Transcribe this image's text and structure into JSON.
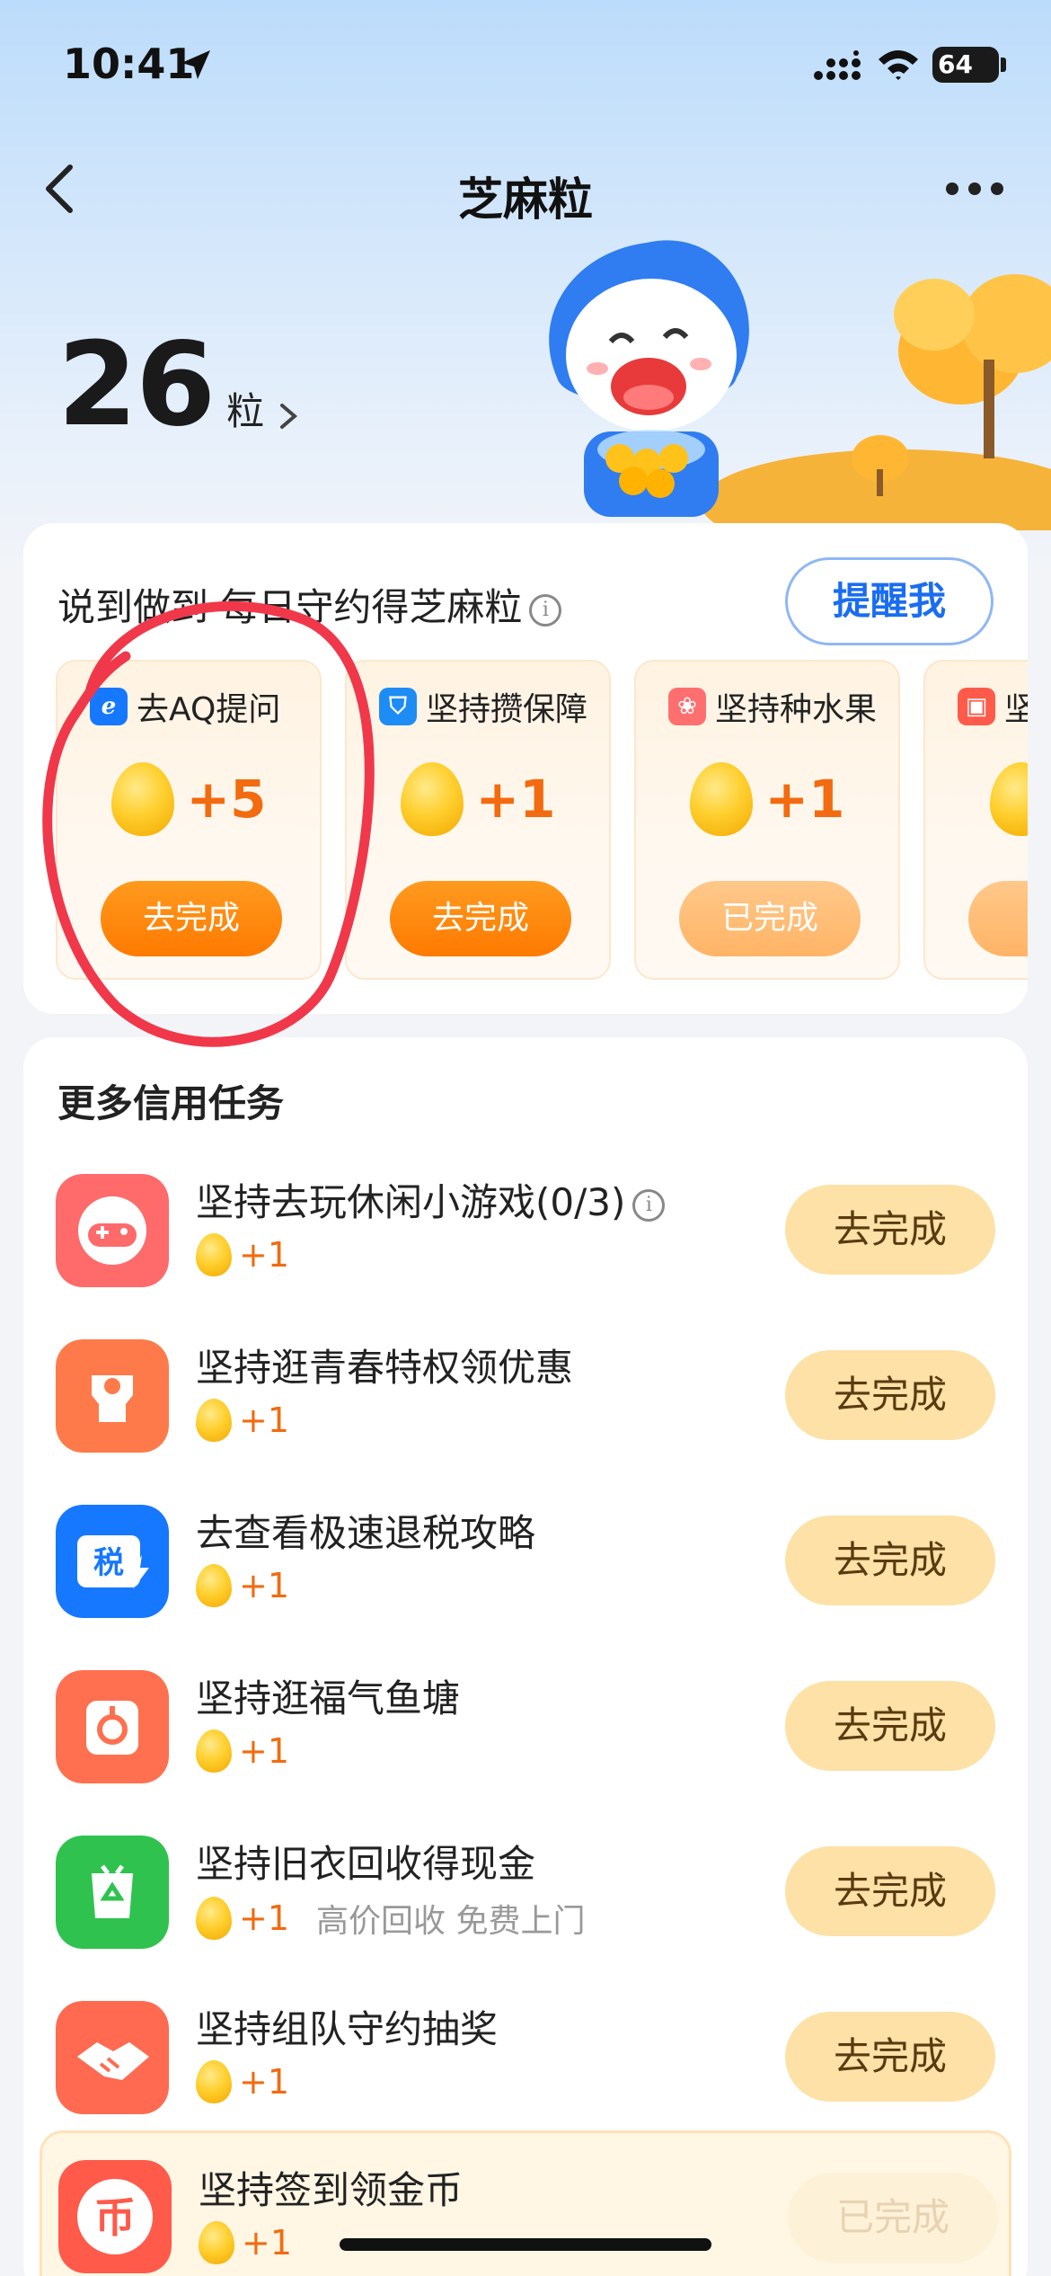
{
  "status_bar": {
    "time": "10:41",
    "battery": "64"
  },
  "nav": {
    "title": "芝麻粒"
  },
  "points": {
    "value": "26",
    "unit": "粒"
  },
  "daily": {
    "title": "说到做到 每日守约得芝麻粒",
    "remind_label": "提醒我",
    "tasks": [
      {
        "name": "去AQ提问",
        "reward": "+5",
        "button": "去完成",
        "icon_color": "#1677ff",
        "icon": "chat-icon"
      },
      {
        "name": "坚持攒保障",
        "reward": "+1",
        "button": "去完成",
        "icon_color": "#1e8cf5",
        "icon": "shield-icon"
      },
      {
        "name": "坚持种水果",
        "reward": "+1",
        "button": "已完成",
        "icon_color": "#ff6f6f",
        "icon": "fruit-icon"
      },
      {
        "name": "坚",
        "reward": "",
        "button": "已",
        "icon_color": "#ff5a4a",
        "icon": "gift-icon"
      }
    ]
  },
  "more": {
    "title": "更多信用任务",
    "items": [
      {
        "title": "坚持去玩休闲小游戏(0/3)",
        "reward": "+1",
        "sub": "",
        "button": "去完成",
        "icon_color": "#ff6a6a",
        "icon": "gamepad-icon"
      },
      {
        "title": "坚持逛青春特权领优惠",
        "reward": "+1",
        "sub": "",
        "button": "去完成",
        "icon_color": "#ff7a4a",
        "icon": "youth-icon"
      },
      {
        "title": "去查看极速退税攻略",
        "reward": "+1",
        "sub": "",
        "button": "去完成",
        "icon_color": "#1677ff",
        "icon": "tax-icon"
      },
      {
        "title": "坚持逛福气鱼塘",
        "reward": "+1",
        "sub": "",
        "button": "去完成",
        "icon_color": "#ff7050",
        "icon": "fish-bag-icon"
      },
      {
        "title": "坚持旧衣回收得现金",
        "reward": "+1",
        "sub": "高价回收 免费上门",
        "button": "去完成",
        "icon_color": "#2fc24f",
        "icon": "recycle-icon"
      },
      {
        "title": "坚持组队守约抽奖",
        "reward": "+1",
        "sub": "",
        "button": "去完成",
        "icon_color": "#ff6a50",
        "icon": "handshake-icon"
      },
      {
        "title": "坚持签到领金币",
        "reward": "+1",
        "sub": "",
        "button": "已完成",
        "icon_color": "#ff5a4a",
        "icon": "coin-icon"
      }
    ]
  },
  "tax_icon_text": "税",
  "coin_icon_text": "币"
}
